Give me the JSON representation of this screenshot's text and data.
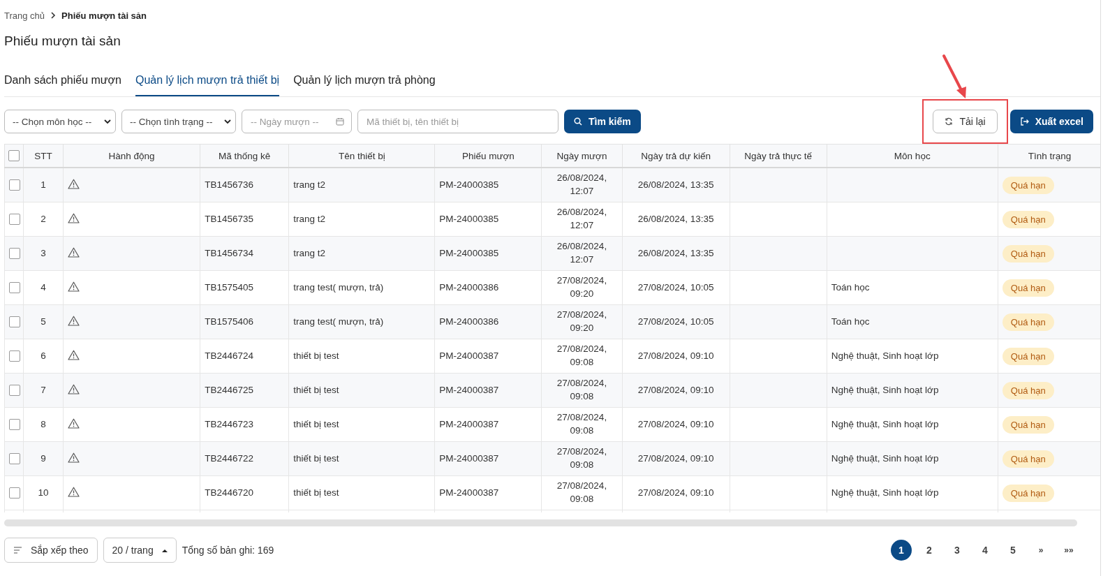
{
  "breadcrumb": [
    {
      "label": "Trang chủ",
      "current": false
    },
    {
      "label": "Phiếu mượn tài sản",
      "current": true
    }
  ],
  "page_title": "Phiếu mượn tài sản",
  "tabs": [
    {
      "label": "Danh sách phiếu mượn",
      "selected": false
    },
    {
      "label": "Quản lý lịch mượn trả thiết bị",
      "selected": true
    },
    {
      "label": "Quản lý lịch mượn trả phòng",
      "selected": false
    }
  ],
  "filters": {
    "subject_select": "-- Chọn môn học --",
    "status_select": "-- Chọn tình trạng --",
    "date_field": {
      "placeholder": "-- Ngày mượn --"
    },
    "search_field": {
      "placeholder": "Mã thiết bị, tên thiết bị"
    },
    "search_button": "Tìm kiếm"
  },
  "actions": {
    "reload_button": "Tải lại",
    "export_button": "Xuất excel",
    "reload_highlighted": true
  },
  "table": {
    "select_all_checked": false,
    "columns": [
      "STT",
      "Hành động",
      "Mã thống kê",
      "Tên thiết bị",
      "Phiếu mượn",
      "Ngày mượn",
      "Ngày trả dự kiến",
      "Ngày trả thực tế",
      "Môn học",
      "Tình trạng"
    ],
    "rows": [
      {
        "checked": false,
        "stt": "1",
        "code": "TB1456736",
        "device": "trang t2",
        "slip": "PM-24000385",
        "borrowed": "26/08/2024,\n12:07",
        "due": "26/08/2024, 13:35",
        "status": "Quá hạn"
      },
      {
        "checked": false,
        "stt": "2",
        "code": "TB1456735",
        "device": "trang t2",
        "slip": "PM-24000385",
        "borrowed": "26/08/2024,\n12:07",
        "due": "26/08/2024, 13:35",
        "status": "Quá hạn"
      },
      {
        "checked": false,
        "stt": "3",
        "code": "TB1456734",
        "device": "trang t2",
        "slip": "PM-24000385",
        "borrowed": "26/08/2024,\n12:07",
        "due": "26/08/2024, 13:35",
        "status": "Quá hạn"
      },
      {
        "checked": false,
        "stt": "4",
        "code": "TB1575405",
        "device": "trang test( mượn, trả)",
        "slip": "PM-24000386",
        "borrowed": "27/08/2024,\n09:20",
        "due": "27/08/2024, 10:05",
        "subject": "Toán học",
        "status": "Quá hạn"
      },
      {
        "checked": false,
        "stt": "5",
        "code": "TB1575406",
        "device": "trang test( mượn, trả)",
        "slip": "PM-24000386",
        "borrowed": "27/08/2024,\n09:20",
        "due": "27/08/2024, 10:05",
        "subject": "Toán học",
        "status": "Quá hạn"
      },
      {
        "checked": false,
        "stt": "6",
        "code": "TB2446724",
        "device": "thiết bị test",
        "slip": "PM-24000387",
        "borrowed": "27/08/2024,\n09:08",
        "due": "27/08/2024, 09:10",
        "subject": "Nghệ thuật, Sinh hoạt lớp",
        "status": "Quá hạn"
      },
      {
        "checked": false,
        "stt": "7",
        "code": "TB2446725",
        "device": "thiết bị test",
        "slip": "PM-24000387",
        "borrowed": "27/08/2024,\n09:08",
        "due": "27/08/2024, 09:10",
        "subject": "Nghệ thuật, Sinh hoạt lớp",
        "status": "Quá hạn"
      },
      {
        "checked": false,
        "stt": "8",
        "code": "TB2446723",
        "device": "thiết bị test",
        "slip": "PM-24000387",
        "borrowed": "27/08/2024,\n09:08",
        "due": "27/08/2024, 09:10",
        "subject": "Nghệ thuật, Sinh hoạt lớp",
        "status": "Quá hạn"
      },
      {
        "checked": false,
        "stt": "9",
        "code": "TB2446722",
        "device": "thiết bị test",
        "slip": "PM-24000387",
        "borrowed": "27/08/2024,\n09:08",
        "due": "27/08/2024, 09:10",
        "subject": "Nghệ thuật, Sinh hoạt lớp",
        "status": "Quá hạn"
      },
      {
        "checked": false,
        "stt": "10",
        "code": "TB2446720",
        "device": "thiết bị test",
        "slip": "PM-24000387",
        "borrowed": "27/08/2024,\n09:08",
        "due": "27/08/2024, 09:10",
        "subject": "Nghệ thuật, Sinh hoạt lớp",
        "status": "Quá hạn"
      }
    ]
  },
  "footer": {
    "sort_button": "Sắp xếp theo",
    "page_size": "20 / trang",
    "total": "Tổng số bản ghi: 169",
    "pages": [
      {
        "label": "1",
        "selected": true
      },
      {
        "label": "2",
        "selected": false
      },
      {
        "label": "3",
        "selected": false
      },
      {
        "label": "4",
        "selected": false
      },
      {
        "label": "5",
        "selected": false
      }
    ],
    "next": "»",
    "last": "»»"
  }
}
